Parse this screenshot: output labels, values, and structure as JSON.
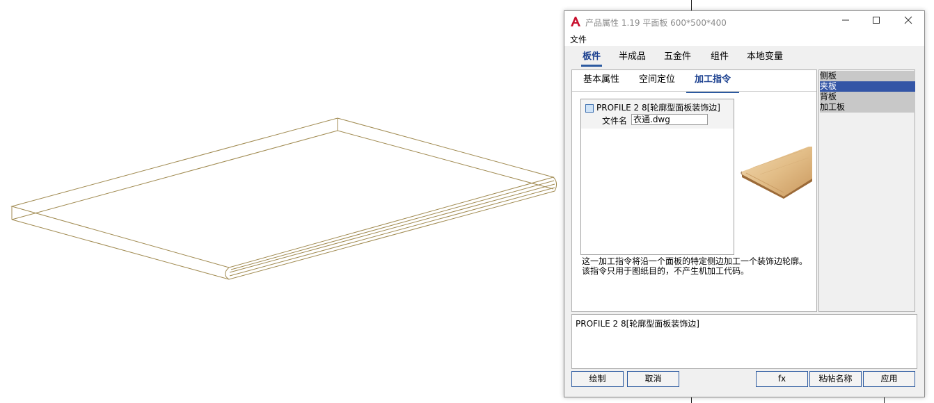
{
  "window": {
    "title": "产品属性 1.19 平面板 600*500*400",
    "min_icon": "minimize-icon",
    "max_icon": "maximize-icon",
    "close_icon": "close-icon"
  },
  "menu": {
    "file": "文件"
  },
  "tabs": [
    {
      "label": "板件",
      "active": true
    },
    {
      "label": "半成品",
      "active": false
    },
    {
      "label": "五金件",
      "active": false
    },
    {
      "label": "组件",
      "active": false
    },
    {
      "label": "本地变量",
      "active": false
    }
  ],
  "subtabs": [
    {
      "label": "基本属性",
      "active": false
    },
    {
      "label": "空间定位",
      "active": false
    },
    {
      "label": "加工指令",
      "active": true
    }
  ],
  "instruction": {
    "title": "PROFILE 2 8[轮廓型面板装饰边]",
    "field_label": "文件名",
    "field_value": "衣通.dwg"
  },
  "description": {
    "line1": "这一加工指令将沿一个面板的特定侧边加工一个装饰边轮廓。",
    "line2": "该指令只用于图纸目的，不产生机加工代码。"
  },
  "side_list": [
    {
      "label": "侧板",
      "selected": false
    },
    {
      "label": "夹板",
      "selected": true
    },
    {
      "label": "背板",
      "selected": false
    },
    {
      "label": "加工板",
      "selected": false
    }
  ],
  "bottom_text": "PROFILE 2 8[轮廓型面板装饰边]",
  "buttons": {
    "draw": "绘制",
    "cancel": "取消",
    "fx": "fx",
    "paste_name": "粘帖名称",
    "apply": "应用"
  },
  "colors": {
    "accent": "#2c5aa0",
    "selection": "#3355a6",
    "drawing_line": "#a08a50"
  }
}
